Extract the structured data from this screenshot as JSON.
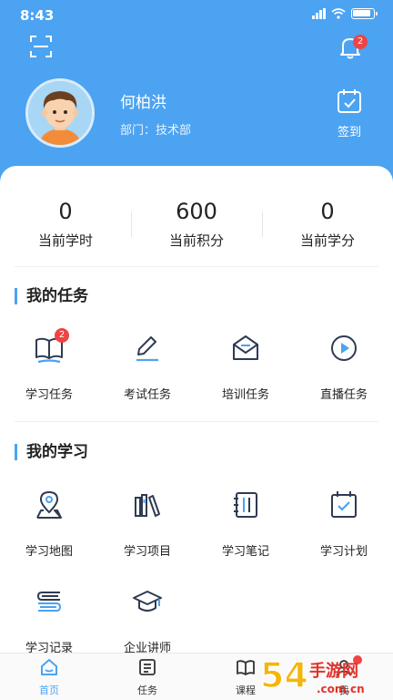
{
  "status_bar": {
    "time": "8:43"
  },
  "header": {
    "notification_count": "2"
  },
  "user": {
    "name": "何柏洪",
    "department": "部门：技术部"
  },
  "checkin": {
    "label": "签到"
  },
  "stats": [
    {
      "value": "0",
      "label": "当前学时"
    },
    {
      "value": "600",
      "label": "当前积分"
    },
    {
      "value": "0",
      "label": "当前学分"
    }
  ],
  "my_tasks": {
    "title": "我的任务",
    "items": [
      {
        "label": "学习任务",
        "icon": "book-open-icon",
        "badge": "2"
      },
      {
        "label": "考试任务",
        "icon": "pen-edit-icon"
      },
      {
        "label": "培训任务",
        "icon": "mail-open-icon"
      },
      {
        "label": "直播任务",
        "icon": "play-circle-icon"
      }
    ]
  },
  "my_learning": {
    "title": "我的学习",
    "items": [
      {
        "label": "学习地图",
        "icon": "map-pin-icon"
      },
      {
        "label": "学习项目",
        "icon": "books-icon"
      },
      {
        "label": "学习笔记",
        "icon": "notebook-icon"
      },
      {
        "label": "学习计划",
        "icon": "calendar-check-icon"
      },
      {
        "label": "学习记录",
        "icon": "stack-records-icon"
      },
      {
        "label": "企业讲师",
        "icon": "graduation-cap-icon"
      }
    ]
  },
  "tabbar": {
    "items": [
      {
        "label": "首页",
        "icon": "home-icon",
        "active": true
      },
      {
        "label": "任务",
        "icon": "task-list-icon"
      },
      {
        "label": "课程",
        "icon": "course-book-icon"
      },
      {
        "label": "我",
        "icon": "profile-icon",
        "badge": ""
      }
    ]
  },
  "watermark": {
    "text": "54 手游网",
    "sub": ".com.cn"
  },
  "colors": {
    "primary": "#4ba3f2",
    "badge": "#ef4444",
    "icon_stroke": "#2f3b52"
  }
}
